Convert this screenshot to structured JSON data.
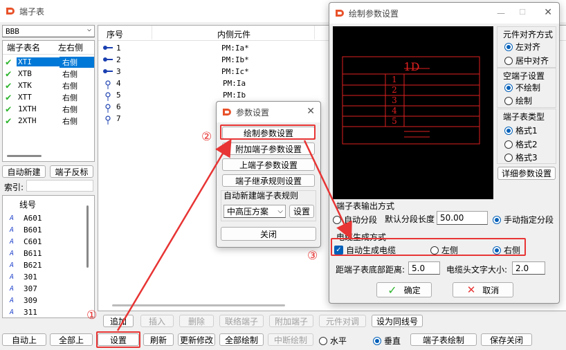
{
  "main": {
    "title": "端子表",
    "dropdown_value": "BBB",
    "terminal_table": {
      "headers": [
        "端子表名",
        "左右侧"
      ],
      "rows": [
        {
          "name": "XTI",
          "side": "右侧"
        },
        {
          "name": "XTB",
          "side": "右侧"
        },
        {
          "name": "XTK",
          "side": "右侧"
        },
        {
          "name": "XTT",
          "side": "右侧"
        },
        {
          "name": "1XTH",
          "side": "右侧"
        },
        {
          "name": "2XTH",
          "side": "右侧"
        }
      ]
    },
    "auto_new_btn": "自动新建",
    "terminal_reverse_btn": "端子反标",
    "index_label": "索引:",
    "wire_header": "线号",
    "wires": [
      "A601",
      "B601",
      "C601",
      "B611",
      "B621",
      "301",
      "307",
      "309",
      "311"
    ],
    "grid_headers": {
      "seq": "序号",
      "inner": "内侧元件"
    },
    "grid_rows": [
      {
        "seq": "1",
        "inner": "PM:Ia*"
      },
      {
        "seq": "2",
        "inner": "PM:Ib*"
      },
      {
        "seq": "3",
        "inner": "PM:Ic*"
      },
      {
        "seq": "4",
        "inner": "PM:Ia"
      },
      {
        "seq": "5",
        "inner": "PM:Ib"
      },
      {
        "seq": "6",
        "inner": "PM:Ic"
      },
      {
        "seq": "7",
        "inner": ""
      }
    ],
    "row1_buttons": [
      "追加",
      "插入",
      "删除",
      "联络端子",
      "附加端子",
      "元件对调",
      "设为同线号"
    ],
    "bottom_buttons": {
      "auto_up": "自动上",
      "all_up": "全部上",
      "settings": "设置",
      "refresh": "刷新",
      "update_changes": "更新修改",
      "draw_all": "全部绘制",
      "break_draw": "中断绘制",
      "horizontal": "水平",
      "vertical": "垂直",
      "table_draw": "端子表绘制",
      "save_close": "保存关闭"
    }
  },
  "param_dialog": {
    "title": "参数设置",
    "buttons": [
      "绘制参数设置",
      "附加端子参数设置",
      "上端子参数设置",
      "端子继承规则设置"
    ],
    "rule_group": "自动新建端子表规则",
    "rule_select": "中高压方案",
    "rule_settings_btn": "设置",
    "close_btn": "关闭"
  },
  "draw_dialog": {
    "title": "绘制参数设置",
    "preview": {
      "header": "1D",
      "rows": [
        "1",
        "2",
        "3",
        "4",
        "5"
      ]
    },
    "align_group": "元件对齐方式",
    "align_options": [
      "左对齐",
      "居中对齐"
    ],
    "empty_group": "空端子设置",
    "empty_options": [
      "不绘制",
      "绘制"
    ],
    "type_group": "端子表类型",
    "type_options": [
      "格式1",
      "格式2",
      "格式3"
    ],
    "detail_btn": "详细参数设置",
    "output_group": "端子表输出方式",
    "auto_segment": "自动分段",
    "default_seg_label": "默认分段长度",
    "default_seg_value": "50.00",
    "manual_segment": "手动指定分段",
    "cable_group": "电缆生成方式",
    "auto_cable": "自动生成电缆",
    "left_side": "左侧",
    "right_side": "右侧",
    "bottom_dist_label": "距端子表底部距离:",
    "bottom_dist_value": "5.0",
    "cable_text_label": "电缆头文字大小:",
    "cable_text_value": "2.0",
    "ok_btn": "确定",
    "cancel_btn": "取消"
  },
  "annotations": [
    "①",
    "②",
    "③"
  ],
  "colors": {
    "accent": "#005fb8",
    "highlight": "#e83434",
    "preview_red": "#e02020",
    "check_green": "#2db52d"
  }
}
